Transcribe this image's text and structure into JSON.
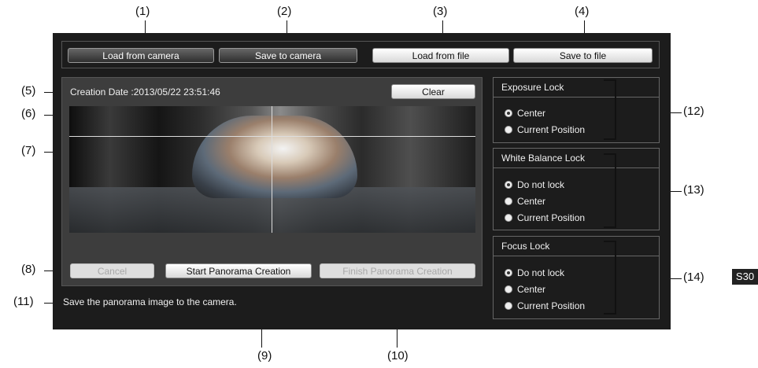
{
  "callouts": {
    "c1": "(1)",
    "c2": "(2)",
    "c3": "(3)",
    "c4": "(4)",
    "c5": "(5)",
    "c6": "(6)",
    "c7": "(7)",
    "c8": "(8)",
    "c9": "(9)",
    "c10": "(10)",
    "c11": "(11)",
    "c12": "(12)",
    "c13": "(13)",
    "c14": "(14)"
  },
  "badge": "S30",
  "toolbar": {
    "load_from_camera": "Load from camera",
    "save_to_camera": "Save to camera",
    "load_from_file": "Load from file",
    "save_to_file": "Save to file"
  },
  "panorama": {
    "creation_date_label": "Creation Date :",
    "creation_date_value": "2013/05/22 23:51:46",
    "clear": "Clear",
    "cancel": "Cancel",
    "start": "Start Panorama Creation",
    "finish": "Finish Panorama Creation",
    "status": "Save the panorama image to the camera."
  },
  "exposure_lock": {
    "title": "Exposure Lock",
    "options": [
      "Center",
      "Current Position"
    ],
    "selected": "Center"
  },
  "white_balance_lock": {
    "title": "White Balance Lock",
    "options": [
      "Do not lock",
      "Center",
      "Current Position"
    ],
    "selected": "Do not lock"
  },
  "focus_lock": {
    "title": "Focus Lock",
    "options": [
      "Do not lock",
      "Center",
      "Current Position"
    ],
    "selected": "Do not lock"
  }
}
